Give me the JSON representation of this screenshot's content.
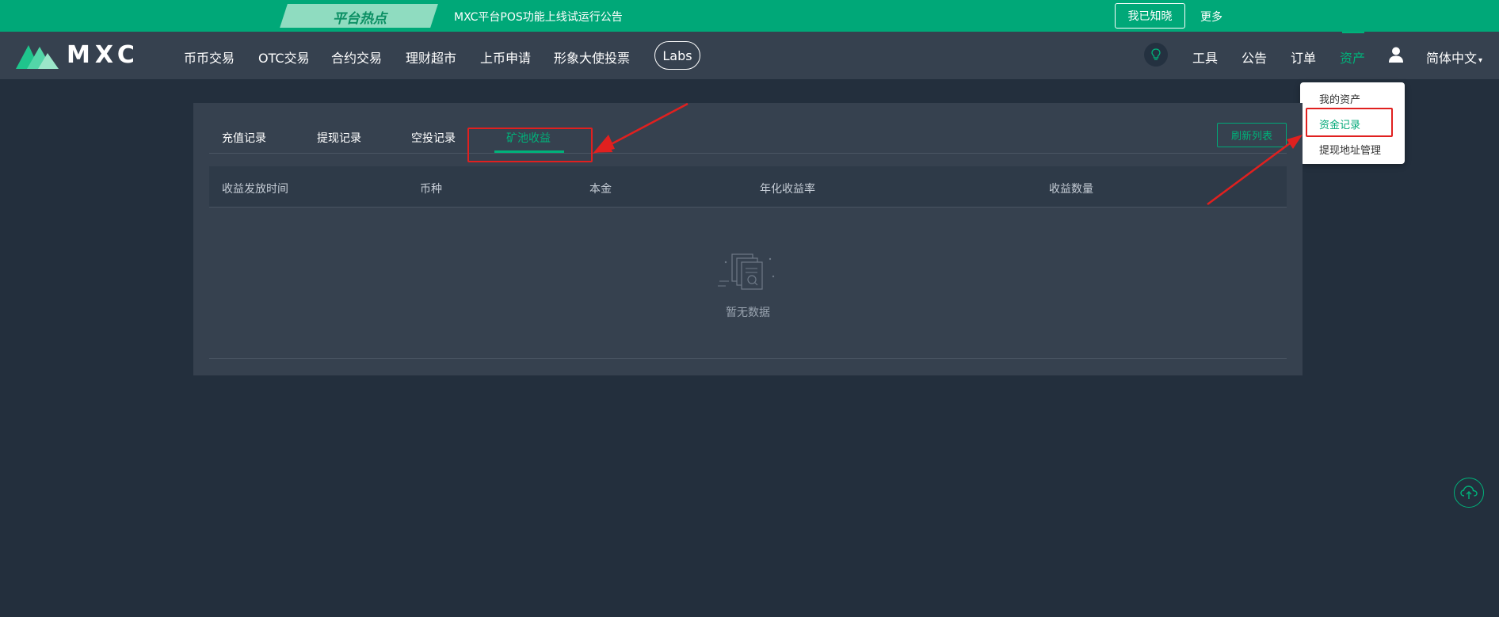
{
  "announcement": {
    "hot_label": "平台热点",
    "text": "MXC平台POS功能上线试运行公告",
    "dismiss_label": "我已知晓",
    "more_label": "更多"
  },
  "header": {
    "logo_text": "MXC",
    "nav": [
      "币币交易",
      "OTC交易",
      "合约交易",
      "理财超市",
      "上币申请",
      "形象大使投票"
    ],
    "labs_label": "Labs",
    "right_nav": [
      "工具",
      "公告",
      "订单",
      "资产"
    ],
    "active_right": "资产",
    "language": "简体中文"
  },
  "asset_dropdown": {
    "items": [
      "我的资产",
      "资金记录",
      "提现地址管理"
    ],
    "active": "资金记录"
  },
  "records": {
    "tabs": [
      "充值记录",
      "提现记录",
      "空投记录",
      "矿池收益"
    ],
    "active_tab": "矿池收益",
    "refresh_label": "刷新列表",
    "columns": [
      "收益发放时间",
      "币种",
      "本金",
      "年化收益率",
      "收益数量"
    ],
    "empty_text": "暂无数据"
  },
  "colors": {
    "brand_green": "#00a878",
    "accent_green": "#00b27a",
    "annotation_red": "#e0201f",
    "background": "#232f3d",
    "panel": "#36414f"
  },
  "icons": [
    "logo-mark-icon",
    "bulb-icon",
    "user-icon",
    "caret-down-icon",
    "empty-data-icon",
    "cloud-upload-icon"
  ]
}
